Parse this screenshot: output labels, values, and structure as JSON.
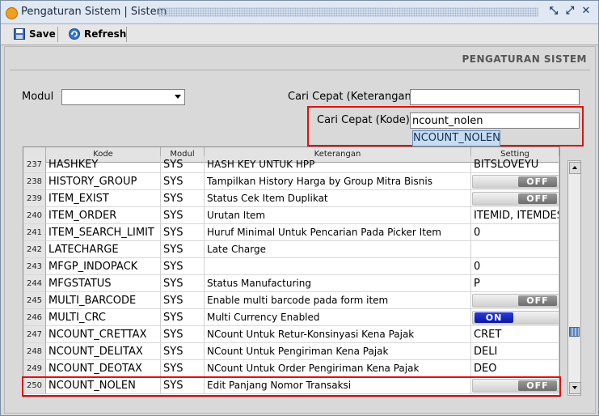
{
  "window": {
    "title": "Pengaturan Sistem | Sistem"
  },
  "toolbar": {
    "save_label": "Save",
    "refresh_label": "Refresh"
  },
  "section_title": "PENGATURAN SISTEM",
  "filters": {
    "modul_label": "Modul",
    "modul_value": "",
    "cari_keterangan_label": "Cari Cepat (Keterangan)",
    "cari_keterangan_value": "",
    "cari_kode_label": "Cari Cepat (Kode)",
    "cari_kode_value": "ncount_nolen",
    "suggestion": "NCOUNT_NOLEN"
  },
  "grid": {
    "columns": [
      "Kode",
      "Modul",
      "Keterangan",
      "Setting"
    ],
    "rows": [
      {
        "no": "237",
        "kode": "HASHKEY",
        "modul": "SYS",
        "ket": "HASH KEY UNTUK HPP",
        "setting": "BITSLOVEYU",
        "toggle": ""
      },
      {
        "no": "238",
        "kode": "HISTORY_GROUP",
        "modul": "SYS",
        "ket": "Tampilkan History Harga by Group Mitra Bisnis",
        "setting": "",
        "toggle": "OFF"
      },
      {
        "no": "239",
        "kode": "ITEM_EXIST",
        "modul": "SYS",
        "ket": "Status Cek Item Duplikat",
        "setting": "",
        "toggle": "OFF"
      },
      {
        "no": "240",
        "kode": "ITEM_ORDER",
        "modul": "SYS",
        "ket": "Urutan Item",
        "setting": "ITEMID, ITEMDES",
        "toggle": ""
      },
      {
        "no": "241",
        "kode": "ITEM_SEARCH_LIMIT",
        "modul": "SYS",
        "ket": "Huruf Minimal Untuk Pencarian Pada Picker Item",
        "setting": "0",
        "toggle": ""
      },
      {
        "no": "242",
        "kode": "LATECHARGE",
        "modul": "SYS",
        "ket": "Late Charge",
        "setting": "",
        "toggle": ""
      },
      {
        "no": "243",
        "kode": "MFGP_INDOPACK",
        "modul": "SYS",
        "ket": "",
        "setting": "0",
        "toggle": ""
      },
      {
        "no": "244",
        "kode": "MFGSTATUS",
        "modul": "SYS",
        "ket": "Status Manufacturing",
        "setting": "P",
        "toggle": ""
      },
      {
        "no": "245",
        "kode": "MULTI_BARCODE",
        "modul": "SYS",
        "ket": "Enable multi barcode pada form item",
        "setting": "",
        "toggle": "OFF"
      },
      {
        "no": "246",
        "kode": "MULTI_CRC",
        "modul": "SYS",
        "ket": "Multi Currency Enabled",
        "setting": "",
        "toggle": "ON"
      },
      {
        "no": "247",
        "kode": "NCOUNT_CRETTAX",
        "modul": "SYS",
        "ket": "NCount Untuk Retur-Konsinyasi Kena Pajak",
        "setting": "CRET",
        "toggle": ""
      },
      {
        "no": "248",
        "kode": "NCOUNT_DELITAX",
        "modul": "SYS",
        "ket": "NCount Untuk Pengiriman Kena Pajak",
        "setting": "DELI",
        "toggle": ""
      },
      {
        "no": "249",
        "kode": "NCOUNT_DEOTAX",
        "modul": "SYS",
        "ket": "NCount Untuk Order Pengiriman Kena Pajak",
        "setting": "DEO",
        "toggle": ""
      },
      {
        "no": "250",
        "kode": "NCOUNT_NOLEN",
        "modul": "SYS",
        "ket": "Edit Panjang Nomor Transaksi",
        "setting": "",
        "toggle": "OFF"
      }
    ]
  },
  "colors": {
    "highlight": "#e01010",
    "toggle_on": "#0b16a8",
    "toggle_off": "#6e6e6e"
  }
}
